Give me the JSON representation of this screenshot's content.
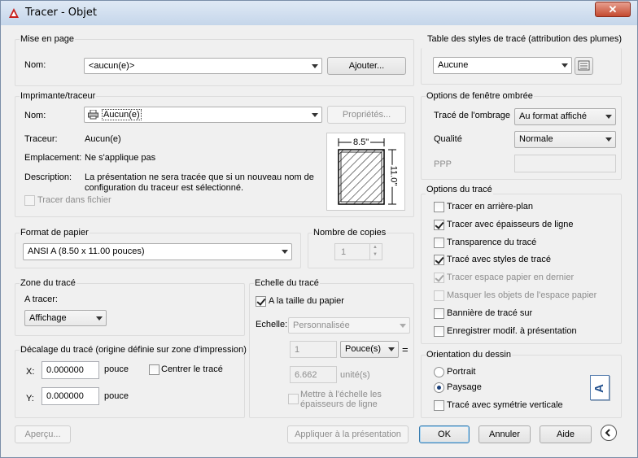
{
  "window": {
    "title": "Tracer - Objet",
    "close": "✕"
  },
  "page_setup": {
    "group": "Mise en page",
    "name_label": "Nom:",
    "name_value": "<aucun(e)>",
    "add_button": "Ajouter..."
  },
  "printer": {
    "group": "Imprimante/traceur",
    "name_label": "Nom:",
    "name_value": "Aucun(e)",
    "properties_button": "Propriétés...",
    "plotter_label": "Traceur:",
    "plotter_value": "Aucun(e)",
    "location_label": "Emplacement:",
    "location_value": "Ne s'applique pas",
    "description_label": "Description:",
    "description_line1": "La présentation ne sera tracée que si un nouveau nom de",
    "description_line2": "configuration du traceur est sélectionné.",
    "plot_to_file": "Tracer dans fichier",
    "dim_width": "8.5\"",
    "dim_height": "11.0\""
  },
  "paper_size": {
    "group": "Format de papier",
    "value": "ANSI A (8.50 x 11.00 pouces)"
  },
  "copies": {
    "group": "Nombre de copies",
    "value": "1"
  },
  "plot_area": {
    "group": "Zone du tracé",
    "what_label": "A tracer:",
    "what_value": "Affichage"
  },
  "plot_offset": {
    "group": "Décalage du tracé (origine définie sur zone d'impression)",
    "x_label": "X:",
    "x_value": "0.000000",
    "x_unit": "pouce",
    "y_label": "Y:",
    "y_value": "0.000000",
    "y_unit": "pouce",
    "center": "Centrer le tracé"
  },
  "plot_scale": {
    "group": "Echelle du tracé",
    "fit": "A la taille du papier",
    "scale_label": "Echelle:",
    "scale_value": "Personnalisée",
    "num": "1",
    "unit_value": "Pouce(s)",
    "equals": "=",
    "den": "6.662",
    "den_unit": "unité(s)",
    "lineweights_line1": "Mettre à l'échelle les",
    "lineweights_line2": "épaisseurs de ligne"
  },
  "style_table": {
    "group": "Table des styles de tracé (attribution des plumes)",
    "value": "Aucune"
  },
  "shaded": {
    "group": "Options de fenêtre ombrée",
    "shade_label": "Tracé de l'ombrage",
    "shade_value": "Au format affiché",
    "quality_label": "Qualité",
    "quality_value": "Normale",
    "dpi_label": "PPP"
  },
  "options": {
    "group": "Options du tracé",
    "items": [
      {
        "label": "Tracer en arrière-plan",
        "checked": false,
        "disabled": false
      },
      {
        "label": "Tracer avec épaisseurs de ligne",
        "checked": true,
        "disabled": false
      },
      {
        "label": "Transparence du tracé",
        "checked": false,
        "disabled": false
      },
      {
        "label": "Tracé avec styles de tracé",
        "checked": true,
        "disabled": false
      },
      {
        "label": "Tracer espace papier en dernier",
        "checked": true,
        "disabled": true
      },
      {
        "label": "Masquer les objets de l'espace papier",
        "checked": false,
        "disabled": true
      },
      {
        "label": "Bannière de tracé sur",
        "checked": false,
        "disabled": false
      },
      {
        "label": "Enregistrer modif. à présentation",
        "checked": false,
        "disabled": false
      }
    ]
  },
  "orientation": {
    "group": "Orientation du dessin",
    "portrait": "Portrait",
    "landscape": "Paysage",
    "upside_down": "Tracé avec symétrie verticale",
    "icon_letter": "A"
  },
  "footer": {
    "preview": "Aperçu...",
    "apply": "Appliquer à la présentation",
    "ok": "OK",
    "cancel": "Annuler",
    "help": "Aide"
  }
}
